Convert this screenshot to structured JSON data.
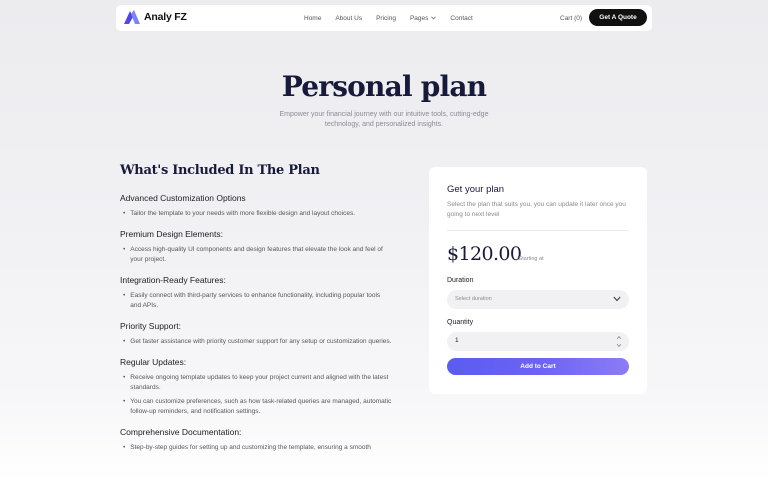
{
  "nav": {
    "brand": "Analy FZ",
    "links": [
      "Home",
      "About Us",
      "Pricing",
      "Pages",
      "Contact"
    ],
    "cart": "Cart (0)",
    "quote_button": "Get A Quote"
  },
  "hero": {
    "title": "Personal plan",
    "subtitle": "Empower your financial journey with our intuitive tools, cutting-edge technology, and personalized insights."
  },
  "included": {
    "title": "What's Included In The Plan",
    "features": [
      {
        "heading": "Advanced Customization Options",
        "bullets": [
          "Tailor the template to your needs with more flexible design and layout choices."
        ]
      },
      {
        "heading": "Premium Design Elements:",
        "bullets": [
          "Access high-quality UI components and design features that elevate the look and feel of your project."
        ]
      },
      {
        "heading": "Integration-Ready Features:",
        "bullets": [
          "Easily connect with third-party services to enhance functionality, including popular tools and APIs."
        ]
      },
      {
        "heading": "Priority Support:",
        "bullets": [
          "Get faster assistance with priority customer support for any setup or customization queries."
        ]
      },
      {
        "heading": "Regular Updates:",
        "bullets": [
          "Receive ongoing template updates to keep your project current and aligned with the latest standards.",
          "You can customize preferences, such as how task-related queries are managed, automatic follow-up reminders, and notification settings."
        ]
      },
      {
        "heading": "Comprehensive Documentation:",
        "bullets": [
          "Step-by-step guides for setting up and customizing the template, ensuring a smooth"
        ]
      }
    ]
  },
  "card": {
    "title": "Get your plan",
    "description": "Select the plan that suits you, you can update it later once you going to next level",
    "price": "$120.00",
    "price_note": "/Starting at",
    "duration_label": "Duration",
    "duration_placeholder": "Select duration",
    "quantity_label": "Quantity",
    "quantity_value": "1",
    "add_button": "Add to Cart"
  },
  "colors": {
    "accent": "#5a5cf0",
    "accent_end": "#8b7cf6",
    "heading": "#171a3a",
    "dark_button": "#111111"
  },
  "icons": [
    "logo-mark-icon",
    "chevron-down-icon",
    "chevron-up-icon"
  ]
}
